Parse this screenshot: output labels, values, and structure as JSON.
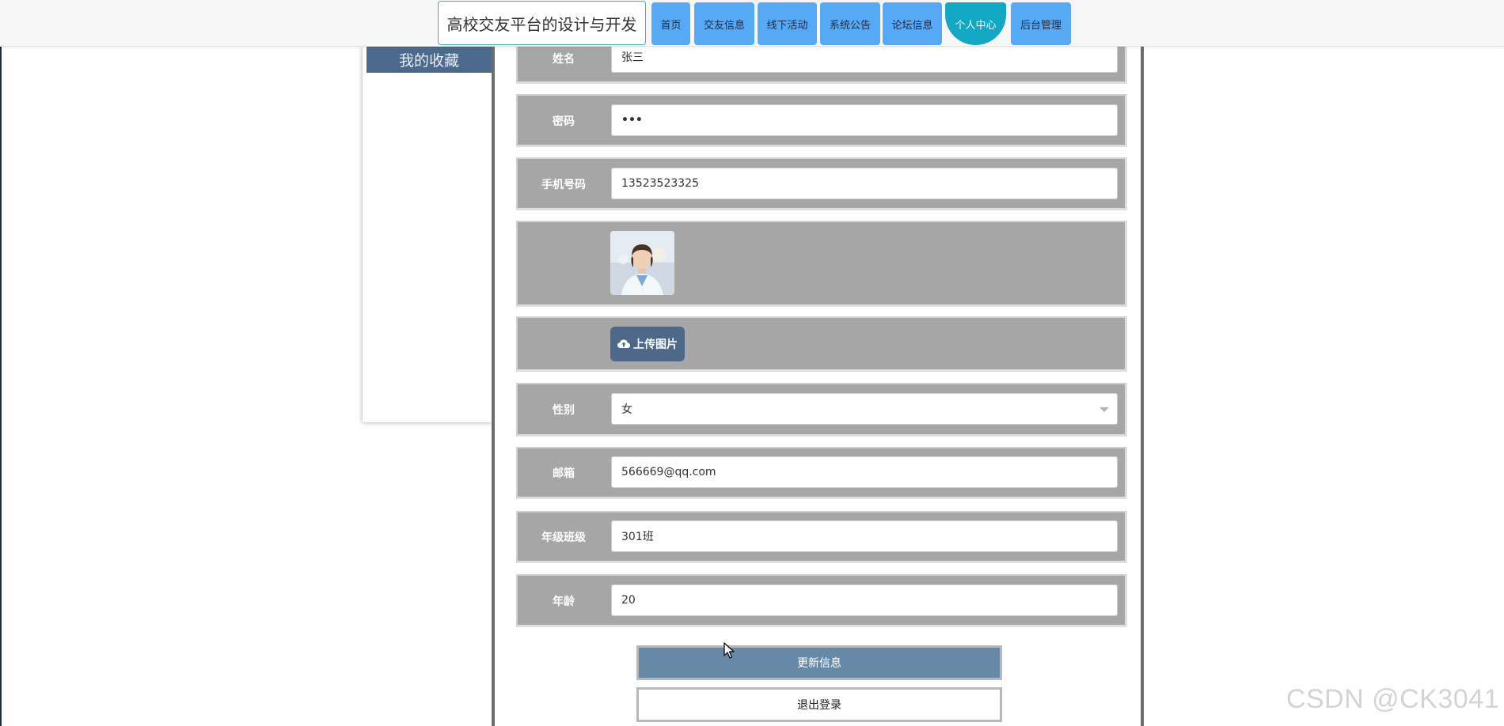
{
  "header": {
    "site_title": "高校交友平台的设计与开发",
    "nav": [
      "首页",
      "交友信息",
      "线下活动",
      "系统公告",
      "论坛信息",
      "个人中心",
      "后台管理"
    ],
    "active_nav": "个人中心"
  },
  "sidebar": {
    "items": [
      {
        "label": "我的收藏"
      }
    ]
  },
  "form": {
    "name": {
      "label": "姓名",
      "value": "张三"
    },
    "password": {
      "label": "密码",
      "value": "•••"
    },
    "phone": {
      "label": "手机号码",
      "value": "13523523325"
    },
    "upload": {
      "label": "上传图片"
    },
    "gender": {
      "label": "性别",
      "value": "女"
    },
    "email": {
      "label": "邮箱",
      "value": "566669@qq.com"
    },
    "class": {
      "label": "年级班级",
      "value": "301班"
    },
    "age": {
      "label": "年龄",
      "value": "20"
    }
  },
  "actions": {
    "update": "更新信息",
    "logout": "退出登录"
  },
  "watermark": "CSDN @CK3041",
  "icons": {
    "upload": "cloud-upload-icon",
    "dropdown": "caret-down-icon",
    "cursor": "mouse-cursor-icon"
  },
  "colors": {
    "nav": "#56aaf5",
    "nav_active": "#12a7c2",
    "sidebar": "#4b6a8c",
    "update_button": "#6789a8"
  }
}
